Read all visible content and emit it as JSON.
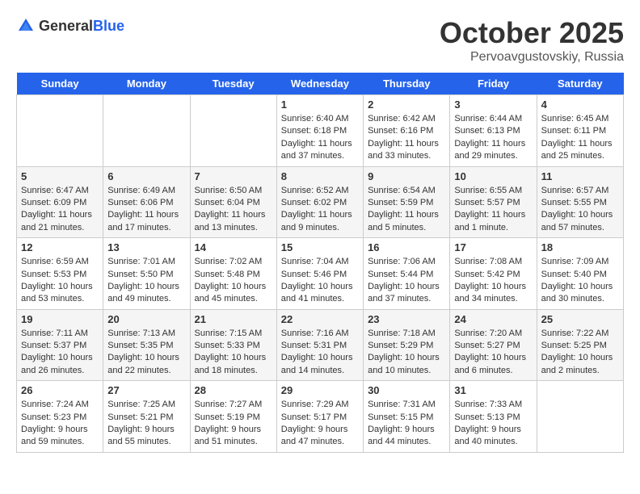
{
  "header": {
    "logo_general": "General",
    "logo_blue": "Blue",
    "month": "October 2025",
    "location": "Pervoavgustovskiy, Russia"
  },
  "weekdays": [
    "Sunday",
    "Monday",
    "Tuesday",
    "Wednesday",
    "Thursday",
    "Friday",
    "Saturday"
  ],
  "weeks": [
    [
      {
        "day": "",
        "info": ""
      },
      {
        "day": "",
        "info": ""
      },
      {
        "day": "",
        "info": ""
      },
      {
        "day": "1",
        "info": "Sunrise: 6:40 AM\nSunset: 6:18 PM\nDaylight: 11 hours\nand 37 minutes."
      },
      {
        "day": "2",
        "info": "Sunrise: 6:42 AM\nSunset: 6:16 PM\nDaylight: 11 hours\nand 33 minutes."
      },
      {
        "day": "3",
        "info": "Sunrise: 6:44 AM\nSunset: 6:13 PM\nDaylight: 11 hours\nand 29 minutes."
      },
      {
        "day": "4",
        "info": "Sunrise: 6:45 AM\nSunset: 6:11 PM\nDaylight: 11 hours\nand 25 minutes."
      }
    ],
    [
      {
        "day": "5",
        "info": "Sunrise: 6:47 AM\nSunset: 6:09 PM\nDaylight: 11 hours\nand 21 minutes."
      },
      {
        "day": "6",
        "info": "Sunrise: 6:49 AM\nSunset: 6:06 PM\nDaylight: 11 hours\nand 17 minutes."
      },
      {
        "day": "7",
        "info": "Sunrise: 6:50 AM\nSunset: 6:04 PM\nDaylight: 11 hours\nand 13 minutes."
      },
      {
        "day": "8",
        "info": "Sunrise: 6:52 AM\nSunset: 6:02 PM\nDaylight: 11 hours\nand 9 minutes."
      },
      {
        "day": "9",
        "info": "Sunrise: 6:54 AM\nSunset: 5:59 PM\nDaylight: 11 hours\nand 5 minutes."
      },
      {
        "day": "10",
        "info": "Sunrise: 6:55 AM\nSunset: 5:57 PM\nDaylight: 11 hours\nand 1 minute."
      },
      {
        "day": "11",
        "info": "Sunrise: 6:57 AM\nSunset: 5:55 PM\nDaylight: 10 hours\nand 57 minutes."
      }
    ],
    [
      {
        "day": "12",
        "info": "Sunrise: 6:59 AM\nSunset: 5:53 PM\nDaylight: 10 hours\nand 53 minutes."
      },
      {
        "day": "13",
        "info": "Sunrise: 7:01 AM\nSunset: 5:50 PM\nDaylight: 10 hours\nand 49 minutes."
      },
      {
        "day": "14",
        "info": "Sunrise: 7:02 AM\nSunset: 5:48 PM\nDaylight: 10 hours\nand 45 minutes."
      },
      {
        "day": "15",
        "info": "Sunrise: 7:04 AM\nSunset: 5:46 PM\nDaylight: 10 hours\nand 41 minutes."
      },
      {
        "day": "16",
        "info": "Sunrise: 7:06 AM\nSunset: 5:44 PM\nDaylight: 10 hours\nand 37 minutes."
      },
      {
        "day": "17",
        "info": "Sunrise: 7:08 AM\nSunset: 5:42 PM\nDaylight: 10 hours\nand 34 minutes."
      },
      {
        "day": "18",
        "info": "Sunrise: 7:09 AM\nSunset: 5:40 PM\nDaylight: 10 hours\nand 30 minutes."
      }
    ],
    [
      {
        "day": "19",
        "info": "Sunrise: 7:11 AM\nSunset: 5:37 PM\nDaylight: 10 hours\nand 26 minutes."
      },
      {
        "day": "20",
        "info": "Sunrise: 7:13 AM\nSunset: 5:35 PM\nDaylight: 10 hours\nand 22 minutes."
      },
      {
        "day": "21",
        "info": "Sunrise: 7:15 AM\nSunset: 5:33 PM\nDaylight: 10 hours\nand 18 minutes."
      },
      {
        "day": "22",
        "info": "Sunrise: 7:16 AM\nSunset: 5:31 PM\nDaylight: 10 hours\nand 14 minutes."
      },
      {
        "day": "23",
        "info": "Sunrise: 7:18 AM\nSunset: 5:29 PM\nDaylight: 10 hours\nand 10 minutes."
      },
      {
        "day": "24",
        "info": "Sunrise: 7:20 AM\nSunset: 5:27 PM\nDaylight: 10 hours\nand 6 minutes."
      },
      {
        "day": "25",
        "info": "Sunrise: 7:22 AM\nSunset: 5:25 PM\nDaylight: 10 hours\nand 2 minutes."
      }
    ],
    [
      {
        "day": "26",
        "info": "Sunrise: 7:24 AM\nSunset: 5:23 PM\nDaylight: 9 hours\nand 59 minutes."
      },
      {
        "day": "27",
        "info": "Sunrise: 7:25 AM\nSunset: 5:21 PM\nDaylight: 9 hours\nand 55 minutes."
      },
      {
        "day": "28",
        "info": "Sunrise: 7:27 AM\nSunset: 5:19 PM\nDaylight: 9 hours\nand 51 minutes."
      },
      {
        "day": "29",
        "info": "Sunrise: 7:29 AM\nSunset: 5:17 PM\nDaylight: 9 hours\nand 47 minutes."
      },
      {
        "day": "30",
        "info": "Sunrise: 7:31 AM\nSunset: 5:15 PM\nDaylight: 9 hours\nand 44 minutes."
      },
      {
        "day": "31",
        "info": "Sunrise: 7:33 AM\nSunset: 5:13 PM\nDaylight: 9 hours\nand 40 minutes."
      },
      {
        "day": "",
        "info": ""
      }
    ]
  ]
}
